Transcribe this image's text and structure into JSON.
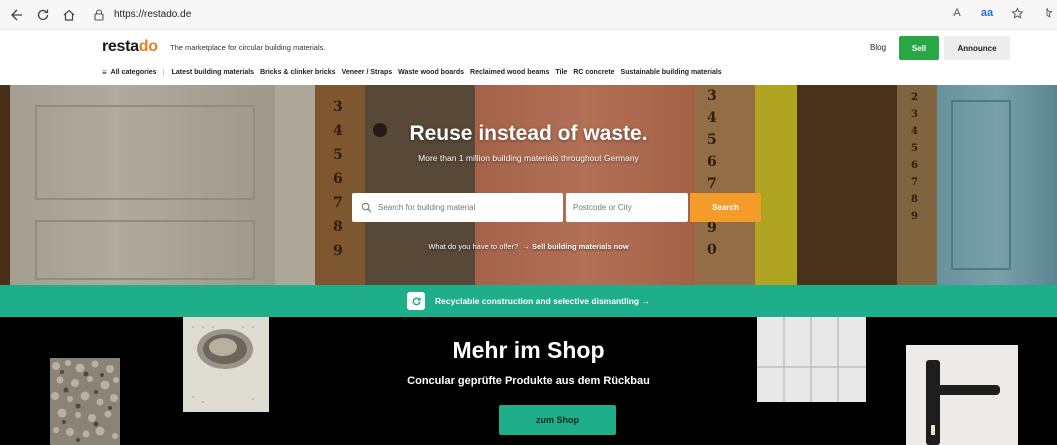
{
  "browser": {
    "url": "https://restado.de",
    "icons": [
      "back-icon",
      "refresh-icon",
      "home-icon",
      "lock-icon",
      "read-aloud-icon",
      "translate-icon",
      "favorites-icon"
    ],
    "right_labels": {
      "read_aloud": "A",
      "translate": "aa"
    }
  },
  "header": {
    "logo": "resta",
    "logo_accent": "do",
    "tagline": "The marketplace for circular building materials.",
    "blog": "Blog",
    "sell": "Sell",
    "announce": "Announce"
  },
  "categories": {
    "all": "All categories",
    "items": [
      "Latest building materials",
      "Bricks & clinker bricks",
      "Veneer / Straps",
      "Waste wood boards",
      "Reclaimed wood beams",
      "Tile",
      "RC concrete",
      "Sustainable building materials"
    ]
  },
  "hero": {
    "title": "Reuse instead of waste.",
    "subtitle": "More than 1 million building materials throughout Germany",
    "search_placeholder": "Search for building material",
    "postcode_placeholder": "Postcode or City",
    "search_button": "Search",
    "offer_question": "What do you have to offer?",
    "offer_link": "→ Sell building materials now"
  },
  "banner": {
    "text": "Recyclable construction and selective dismantling →"
  },
  "shop": {
    "title": "Mehr im Shop",
    "subtitle": "Concular geprüfte Produkte aus dem Rückbau",
    "button": "zum Shop"
  },
  "colors": {
    "brand_orange": "#f07b1e",
    "sell_green": "#28a745",
    "banner_green": "#1fae8a",
    "search_orange": "#f39c2a"
  }
}
